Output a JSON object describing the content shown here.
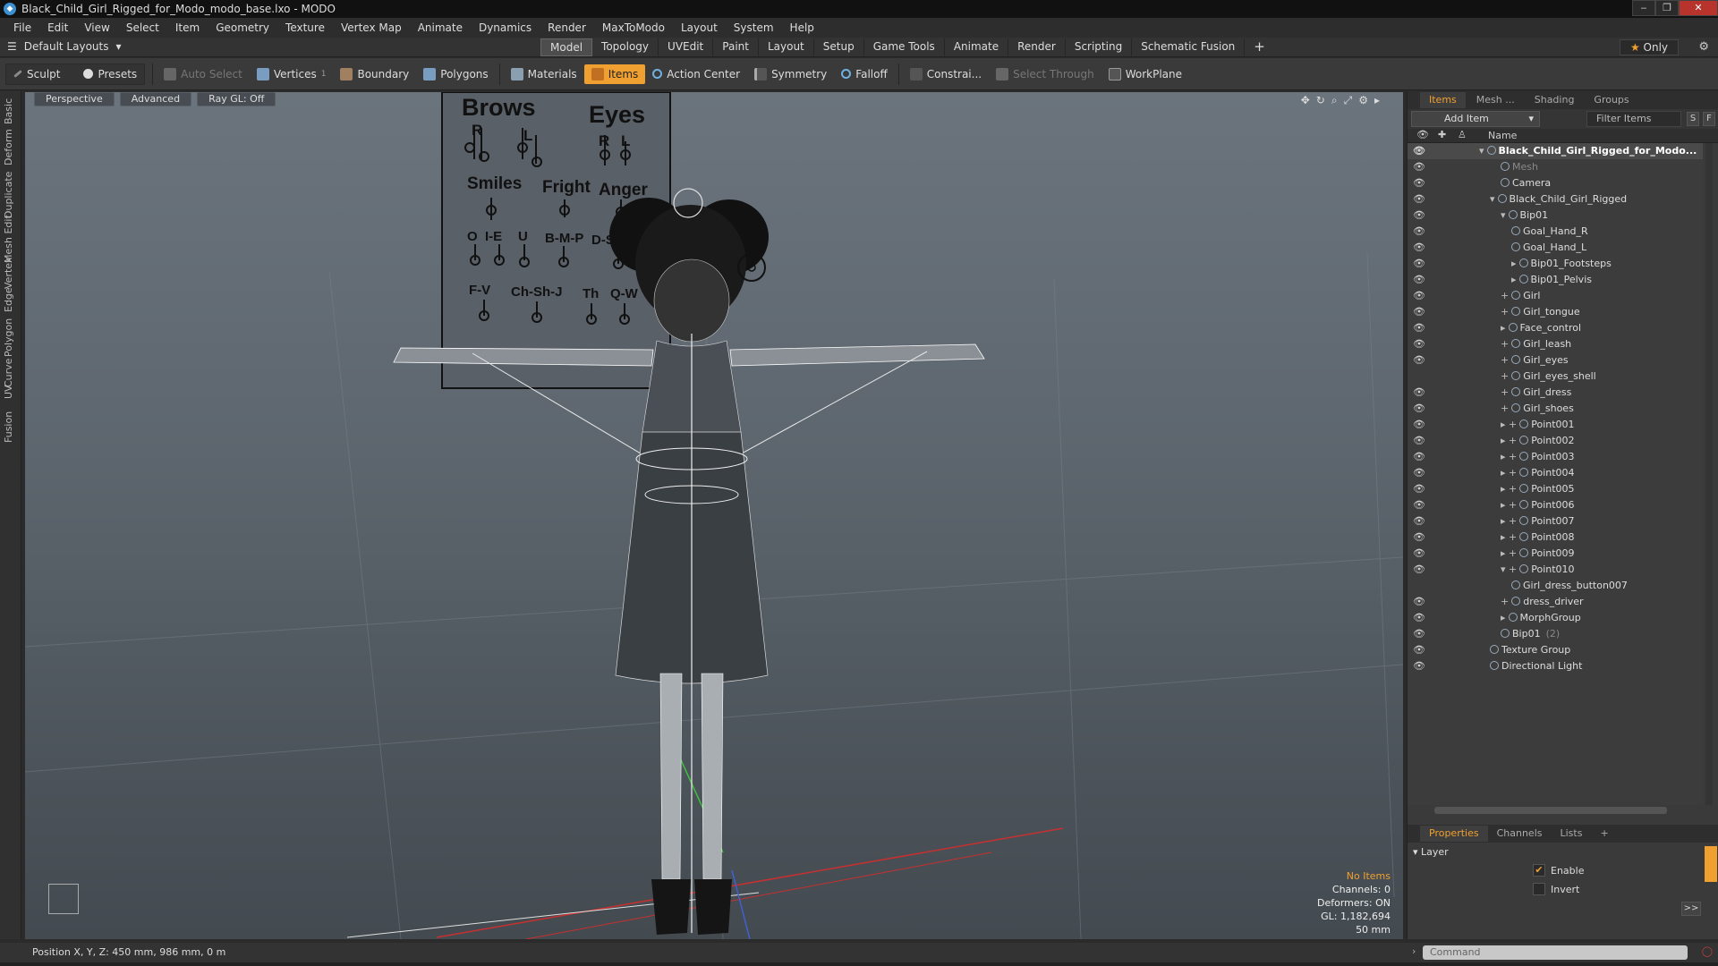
{
  "window": {
    "title": "Black_Child_Girl_Rigged_for_Modo_modo_base.lxo - MODO"
  },
  "menu": [
    "File",
    "Edit",
    "View",
    "Select",
    "Item",
    "Geometry",
    "Texture",
    "Vertex Map",
    "Animate",
    "Dynamics",
    "Render",
    "MaxToModo",
    "Layout",
    "System",
    "Help"
  ],
  "layout": {
    "dropdown": "Default Layouts",
    "tabs": [
      "Model",
      "Topology",
      "UVEdit",
      "Paint",
      "Layout",
      "Setup",
      "Game Tools",
      "Animate",
      "Render",
      "Scripting",
      "Schematic Fusion"
    ],
    "active_tab": "Model",
    "only_label": "Only"
  },
  "toolbar": {
    "sculpt": "Sculpt",
    "presets": "Presets",
    "auto_select": "Auto Select",
    "vertices": "Vertices",
    "vertices_count": "1",
    "boundary": "Boundary",
    "polygons": "Polygons",
    "materials": "Materials",
    "items": "Items",
    "action_center": "Action Center",
    "symmetry": "Symmetry",
    "falloff": "Falloff",
    "constraints": "Constrai...",
    "select_through": "Select Through",
    "workplane": "WorkPlane"
  },
  "left_tabs": [
    "Basic",
    "Deform",
    "Duplicate",
    "Mesh Edit",
    "Vertex",
    "Edge",
    "Polygon",
    "Curve",
    "UV",
    "Fusion"
  ],
  "viewport": {
    "view": "Perspective",
    "shading": "Advanced",
    "raygl": "Ray GL: Off",
    "chart": {
      "brows": "Brows",
      "eyes": "Eyes",
      "r": "R",
      "l": "L",
      "smiles": "Smiles",
      "fright": "Fright",
      "anger": "Anger",
      "o": "O",
      "ie": "I-E",
      "u": "U",
      "bmp": "B-M-P",
      "dstz": "D-S-T-Z",
      "fv": "F-V",
      "chshj": "Ch-Sh-J",
      "th": "Th",
      "qw": "Q-W"
    },
    "stats": {
      "no_items": "No Items",
      "channels": "Channels: 0",
      "deformers": "Deformers: ON",
      "gl": "GL: 1,182,694",
      "distance": "50 mm"
    }
  },
  "status": {
    "position": "Position X, Y, Z:  450 mm, 986 mm, 0 m"
  },
  "items_panel": {
    "tabs": [
      "Items",
      "Mesh ...",
      "Shading",
      "Groups"
    ],
    "add_item": "Add Item",
    "filter": "Filter Items",
    "s_btn": "S",
    "f_btn": "F",
    "column_name": "Name",
    "tree": [
      {
        "label": "Black_Child_Girl_Rigged_for_Modo...",
        "indent": 0,
        "arrow": "▾",
        "sel": true,
        "eye": true
      },
      {
        "label": "Mesh",
        "indent": 2,
        "arrow": "",
        "dim": true,
        "eye": true
      },
      {
        "label": "Camera",
        "indent": 2,
        "arrow": "",
        "eye": true
      },
      {
        "label": "Black_Child_Girl_Rigged",
        "indent": 1,
        "arrow": "▾",
        "eye": true
      },
      {
        "label": "Bip01",
        "indent": 2,
        "arrow": "▾",
        "eye": true
      },
      {
        "label": "Goal_Hand_R",
        "indent": 3,
        "arrow": "",
        "eye": true
      },
      {
        "label": "Goal_Hand_L",
        "indent": 3,
        "arrow": "",
        "eye": true
      },
      {
        "label": "Bip01_Footsteps",
        "indent": 3,
        "arrow": "▸",
        "eye": true
      },
      {
        "label": "Bip01_Pelvis",
        "indent": 3,
        "arrow": "▸",
        "eye": true
      },
      {
        "label": "Girl",
        "indent": 2,
        "arrow": "+",
        "eye": true
      },
      {
        "label": "Girl_tongue",
        "indent": 2,
        "arrow": "+",
        "eye": true
      },
      {
        "label": "Face_control",
        "indent": 2,
        "arrow": "▸",
        "eye": true
      },
      {
        "label": "Girl_leash",
        "indent": 2,
        "arrow": "+",
        "eye": true
      },
      {
        "label": "Girl_eyes",
        "indent": 2,
        "arrow": "+",
        "eye": true
      },
      {
        "label": "Girl_eyes_shell",
        "indent": 2,
        "arrow": "+",
        "eye": false
      },
      {
        "label": "Girl_dress",
        "indent": 2,
        "arrow": "+",
        "eye": true
      },
      {
        "label": "Girl_shoes",
        "indent": 2,
        "arrow": "+",
        "eye": true
      },
      {
        "label": "Point001",
        "indent": 2,
        "arrow": "▸ +",
        "eye": true
      },
      {
        "label": "Point002",
        "indent": 2,
        "arrow": "▸ +",
        "eye": true
      },
      {
        "label": "Point003",
        "indent": 2,
        "arrow": "▸ +",
        "eye": true
      },
      {
        "label": "Point004",
        "indent": 2,
        "arrow": "▸ +",
        "eye": true
      },
      {
        "label": "Point005",
        "indent": 2,
        "arrow": "▸ +",
        "eye": true
      },
      {
        "label": "Point006",
        "indent": 2,
        "arrow": "▸ +",
        "eye": true
      },
      {
        "label": "Point007",
        "indent": 2,
        "arrow": "▸ +",
        "eye": true
      },
      {
        "label": "Point008",
        "indent": 2,
        "arrow": "▸ +",
        "eye": true
      },
      {
        "label": "Point009",
        "indent": 2,
        "arrow": "▸ +",
        "eye": true
      },
      {
        "label": "Point010",
        "indent": 2,
        "arrow": "▾ +",
        "eye": true
      },
      {
        "label": "Girl_dress_button007",
        "indent": 3,
        "arrow": "",
        "eye": false
      },
      {
        "label": "dress_driver",
        "indent": 2,
        "arrow": "+",
        "eye": true
      },
      {
        "label": "MorphGroup",
        "indent": 2,
        "arrow": "▸",
        "eye": true
      },
      {
        "label": "Bip01",
        "suffix": "(2)",
        "indent": 2,
        "arrow": "",
        "eye": true
      },
      {
        "label": "Texture Group",
        "indent": 1,
        "arrow": "",
        "eye": true
      },
      {
        "label": "Directional Light",
        "indent": 1,
        "arrow": "",
        "eye": true
      }
    ]
  },
  "properties": {
    "tabs": [
      "Properties",
      "Channels",
      "Lists"
    ],
    "layer": "Layer",
    "enable": "Enable",
    "invert": "Invert"
  },
  "command": {
    "placeholder": "Command"
  },
  "colors": {
    "accent": "#f0a030",
    "viewport_top": "#6b747d",
    "viewport_bottom": "#434a50"
  }
}
